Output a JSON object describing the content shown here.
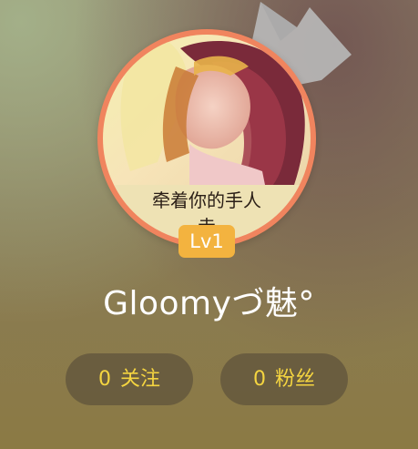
{
  "profile": {
    "username": "Gloomyづ魅°",
    "level": "Lv1",
    "avatar_caption_line1": "牵着你的手人",
    "avatar_caption_line2": "走"
  },
  "stats": {
    "following": {
      "count": "0",
      "label": "关注"
    },
    "fans": {
      "count": "0",
      "label": "粉丝"
    }
  },
  "colors": {
    "avatar_ring": "#f0845e",
    "level_badge": "#f3b33f",
    "stat_text": "#f5d540",
    "username_text": "#ffffff"
  },
  "icons": {
    "crown": "crown-icon"
  }
}
